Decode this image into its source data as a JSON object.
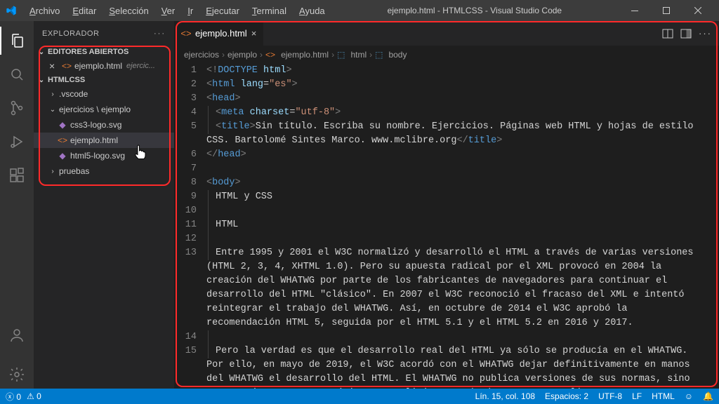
{
  "window": {
    "title": "ejemplo.html - HTMLCSS - Visual Studio Code"
  },
  "menu": {
    "items": [
      "Archivo",
      "Editar",
      "Selección",
      "Ver",
      "Ir",
      "Ejecutar",
      "Terminal",
      "Ayuda"
    ]
  },
  "sidebar": {
    "title": "EXPLORADOR",
    "open_editors_label": "EDITORES ABIERTOS",
    "open_editors": [
      {
        "name": "ejemplo.html",
        "detail": "ejercic..."
      }
    ],
    "workspace_label": "HTMLCSS",
    "tree": [
      {
        "name": ".vscode",
        "kind": "folder",
        "depth": 1
      },
      {
        "name": "ejercicios \\ ejemplo",
        "kind": "folder-open",
        "depth": 1
      },
      {
        "name": "css3-logo.svg",
        "kind": "svg",
        "depth": 2
      },
      {
        "name": "ejemplo.html",
        "kind": "html",
        "depth": 2,
        "selected": true
      },
      {
        "name": "html5-logo.svg",
        "kind": "svg",
        "depth": 2
      },
      {
        "name": "pruebas",
        "kind": "folder",
        "depth": 1
      }
    ]
  },
  "tabs": {
    "active": "ejemplo.html"
  },
  "breadcrumbs": [
    "ejercicios",
    "ejemplo",
    "ejemplo.html",
    "html",
    "body"
  ],
  "code": {
    "lines": [
      {
        "n": 1,
        "html": "<span class='tok-bracket'>&lt;!</span><span class='tok-doctype'>DOCTYPE</span> <span class='tok-attr'>html</span><span class='tok-bracket'>&gt;</span>"
      },
      {
        "n": 2,
        "html": "<span class='tok-bracket'>&lt;</span><span class='tok-tag'>html</span> <span class='tok-attr'>lang</span>=<span class='tok-str'>\"es\"</span><span class='tok-bracket'>&gt;</span>"
      },
      {
        "n": 3,
        "html": "<span class='tok-bracket'>&lt;</span><span class='tok-tag'>head</span><span class='tok-bracket'>&gt;</span>"
      },
      {
        "n": 4,
        "html": "<span class='indent-guide'></span><span class='tok-bracket'>&lt;</span><span class='tok-tag'>meta</span> <span class='tok-attr'>charset</span>=<span class='tok-str'>\"utf-8\"</span><span class='tok-bracket'>&gt;</span>"
      },
      {
        "n": 5,
        "html": "<span class='indent-guide'></span><span class='tok-bracket'>&lt;</span><span class='tok-tag'>title</span><span class='tok-bracket'>&gt;</span><span class='tok-text'>Sin título. Escriba su nombre. Ejercicios. Páginas web HTML y hojas de estilo CSS. Bartolomé Sintes Marco. www.mclibre.org</span><span class='tok-bracket'>&lt;/</span><span class='tok-tag'>title</span><span class='tok-bracket'>&gt;</span>"
      },
      {
        "n": 6,
        "html": "<span class='tok-bracket'>&lt;/</span><span class='tok-tag'>head</span><span class='tok-bracket'>&gt;</span>"
      },
      {
        "n": 7,
        "html": ""
      },
      {
        "n": 8,
        "html": "<span class='tok-bracket'>&lt;</span><span class='tok-tag'>body</span><span class='tok-bracket'>&gt;</span>"
      },
      {
        "n": 9,
        "html": "<span class='indent-guide'></span><span class='tok-text'>HTML y CSS</span>"
      },
      {
        "n": 10,
        "html": "<span class='indent-guide'></span>"
      },
      {
        "n": 11,
        "html": "<span class='indent-guide'></span><span class='tok-text'>HTML</span>"
      },
      {
        "n": 12,
        "html": "<span class='indent-guide'></span>"
      },
      {
        "n": 13,
        "html": "<span class='indent-guide'></span><span class='tok-text'>Entre 1995 y 2001 el W3C normalizó y desarrolló el HTML a través de varias versiones (HTML 2, 3, 4, XHTML 1.0). Pero su apuesta radical por el XML provocó en 2004 la creación del WHATWG por parte de los fabricantes de navegadores para continuar el desarrollo del HTML \"clásico\". En 2007 el W3C reconoció el fracaso del XML e intentó reintegrar el trabajo del WHATWG. Así, en octubre de 2014 el W3C aprobó la recomendación HTML 5, seguida por el HTML 5.1 y el HTML 5.2 en 2016 y 2017.</span>"
      },
      {
        "n": 14,
        "html": "<span class='indent-guide'></span>"
      },
      {
        "n": 15,
        "html": "<span class='indent-guide'></span><span class='tok-text'>Pero la verdad es que el desarrollo real del HTML ya sólo se producía en el WHATWG. Por ello, en mayo de 2019, el W3C acordó con el WHATWG dejar definitivamente en manos del WHATWG el desarrollo del HTML. El WHATWG no publica versiones de sus normas, sino que mantiene una norma única, HTML living standard, que se actualiza constantemente.</span>"
      }
    ]
  },
  "status": {
    "errors": "0",
    "warnings": "0",
    "cursor": "Lín. 15, col. 108",
    "spaces": "Espacios: 2",
    "encoding": "UTF-8",
    "eol": "LF",
    "lang": "HTML",
    "feedback_icon": "☺",
    "bell_icon": "🔔"
  }
}
